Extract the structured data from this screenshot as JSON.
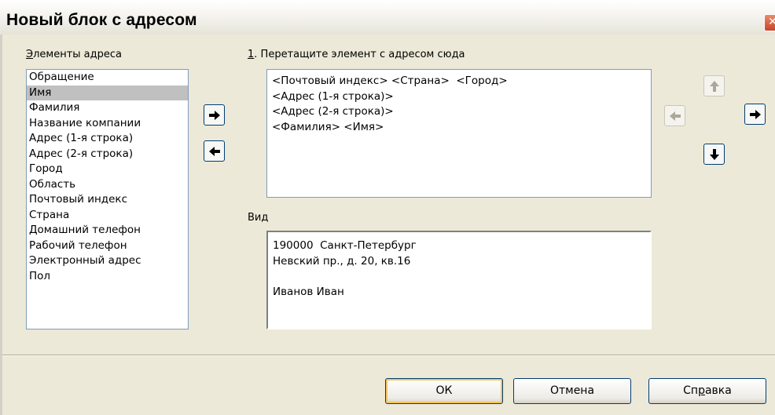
{
  "dialog": {
    "title": "Новый блок с адресом"
  },
  "address_elements": {
    "label_accel": "Э",
    "label_rest": "лементы адреса",
    "items": [
      "Обращение",
      "Имя",
      "Фамилия",
      "Название компании",
      "Адрес (1-я строка)",
      "Адрес (2-я строка)",
      "Город",
      "Область",
      "Почтовый индекс",
      "Страна",
      "Домашний телефон",
      "Рабочий телефон",
      "Электронный адрес",
      "Пол"
    ],
    "selected_index": 1
  },
  "drag_area": {
    "label_accel": "1",
    "label_rest": ". Перетащите элемент с адресом сюда",
    "lines": [
      "<Почтовый индекс> <Страна>  <Город>",
      "<Адрес (1-я строка)>",
      "<Адрес (2-я строка)>",
      "<Фамилия> <Имя>"
    ]
  },
  "preview": {
    "label": "Вид",
    "lines": [
      "190000  Санкт-Петербург",
      "Невский пр., д. 20, кв.16",
      "",
      "Иванов Иван"
    ]
  },
  "buttons": {
    "ok": "ОК",
    "cancel": "Отмена",
    "help_pre": "Сп",
    "help_accel": "р",
    "help_post": "авка"
  },
  "icons": {
    "add": "arrow-right-icon",
    "remove": "arrow-left-icon",
    "move_up": "arrow-up-icon",
    "move_left": "arrow-left-icon",
    "move_right": "arrow-right-icon",
    "move_down": "arrow-down-icon"
  }
}
